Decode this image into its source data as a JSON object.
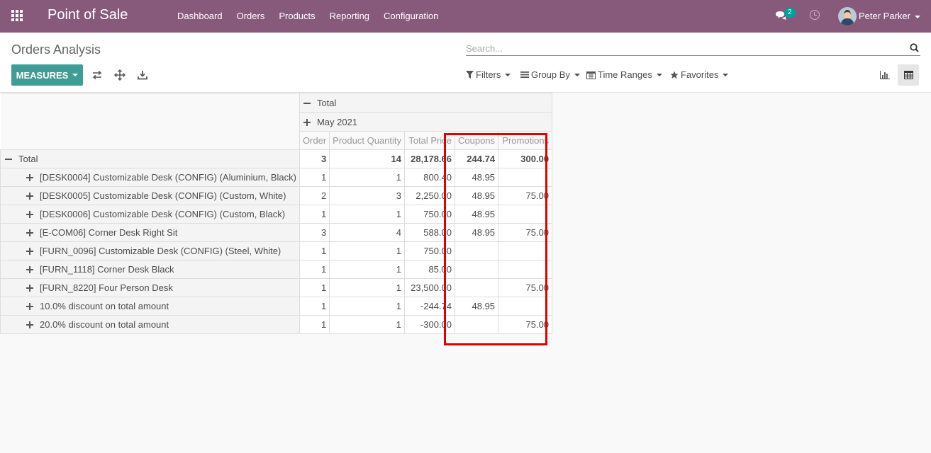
{
  "navbar": {
    "app_title": "Point of Sale",
    "menu": [
      "Dashboard",
      "Orders",
      "Products",
      "Reporting",
      "Configuration"
    ],
    "chat_count": "2",
    "user_name": "Peter Parker",
    "bg_color": "#875a7b"
  },
  "control_panel": {
    "breadcrumb": "Orders Analysis",
    "search_placeholder": "Search...",
    "measures_label": "MEASURES",
    "filters_label": "Filters",
    "group_by_label": "Group By",
    "time_ranges_label": "Time Ranges",
    "favorites_label": "Favorites",
    "accent_color": "#3f9d95"
  },
  "pivot": {
    "col_header_total": "Total",
    "col_header_period": "May 2021",
    "measures": [
      "Order",
      "Product Quantity",
      "Total Price",
      "Coupons",
      "Promotions"
    ],
    "total_row": {
      "label": "Total",
      "values": [
        "3",
        "14",
        "28,178.66",
        "244.74",
        "300.00"
      ]
    },
    "rows": [
      {
        "label": "[DESK0004] Customizable Desk (CONFIG) (Aluminium, Black)",
        "values": [
          "1",
          "1",
          "800.40",
          "48.95",
          ""
        ]
      },
      {
        "label": "[DESK0005] Customizable Desk (CONFIG) (Custom, White)",
        "values": [
          "2",
          "3",
          "2,250.00",
          "48.95",
          "75.00"
        ]
      },
      {
        "label": "[DESK0006] Customizable Desk (CONFIG) (Custom, Black)",
        "values": [
          "1",
          "1",
          "750.00",
          "48.95",
          ""
        ]
      },
      {
        "label": "[E-COM06] Corner Desk Right Sit",
        "values": [
          "3",
          "4",
          "588.00",
          "48.95",
          "75.00"
        ]
      },
      {
        "label": "[FURN_0096] Customizable Desk (CONFIG) (Steel, White)",
        "values": [
          "1",
          "1",
          "750.00",
          "",
          ""
        ]
      },
      {
        "label": "[FURN_1118] Corner Desk Black",
        "values": [
          "1",
          "1",
          "85.00",
          "",
          ""
        ]
      },
      {
        "label": "[FURN_8220] Four Person Desk",
        "values": [
          "1",
          "1",
          "23,500.00",
          "",
          "75.00"
        ]
      },
      {
        "label": "10.0% discount on total amount",
        "values": [
          "1",
          "1",
          "-244.74",
          "48.95",
          ""
        ]
      },
      {
        "label": "20.0% discount on total amount",
        "values": [
          "1",
          "1",
          "-300.00",
          "",
          "75.00"
        ]
      }
    ],
    "highlight_color": "#e00000"
  }
}
